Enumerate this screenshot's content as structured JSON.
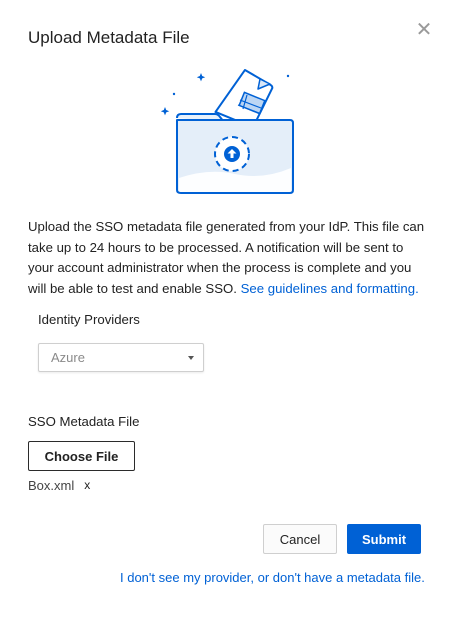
{
  "dialog": {
    "title": "Upload Metadata File",
    "close_icon": "close-icon"
  },
  "illustration": {
    "icon": "folder-upload-icon",
    "accent": "#0061d5"
  },
  "description": {
    "text": "Upload the SSO metadata file generated from your IdP. This file can take up to 24 hours to be processed. A notification will be sent to your account administrator when the process is complete and you will be able to test and enable SSO. ",
    "link": "See guidelines and formatting."
  },
  "identity_providers": {
    "label": "Identity Providers",
    "selected": "Azure",
    "caret_icon": "caret-down-icon"
  },
  "sso_metadata": {
    "label": "SSO Metadata File",
    "choose_label": "Choose File",
    "file_name": "Box.xml",
    "remove_label": "x"
  },
  "actions": {
    "cancel_label": "Cancel",
    "submit_label": "Submit"
  },
  "footer": {
    "help_link": "I don't see my provider, or don't have a metadata file."
  },
  "colors": {
    "primary": "#0061d5",
    "text": "#222222",
    "muted": "#8a8a8a"
  }
}
